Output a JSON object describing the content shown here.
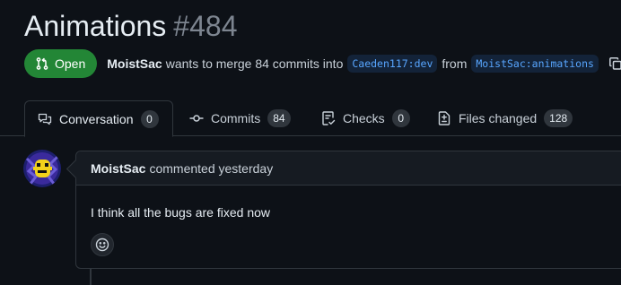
{
  "pr": {
    "title": "Animations",
    "number": "#484",
    "state": "Open",
    "author": "MoistSac",
    "merge_text": "wants to merge 84 commits into",
    "base_branch": "Caeden117:dev",
    "from_text": "from",
    "head_branch": "MoistSac:animations"
  },
  "tabs": [
    {
      "label": "Conversation",
      "count": "0",
      "icon": "comment-discussion-icon"
    },
    {
      "label": "Commits",
      "count": "84",
      "icon": "git-commit-icon"
    },
    {
      "label": "Checks",
      "count": "0",
      "icon": "checklist-icon"
    },
    {
      "label": "Files changed",
      "count": "128",
      "icon": "file-diff-icon"
    }
  ],
  "comment": {
    "author": "MoistSac",
    "action": "commented yesterday",
    "body": "I think all the bugs are fixed now"
  },
  "colors": {
    "background": "#0d1117",
    "open_state": "#238636",
    "branch_text": "#58a6ff",
    "border": "#30363d"
  }
}
